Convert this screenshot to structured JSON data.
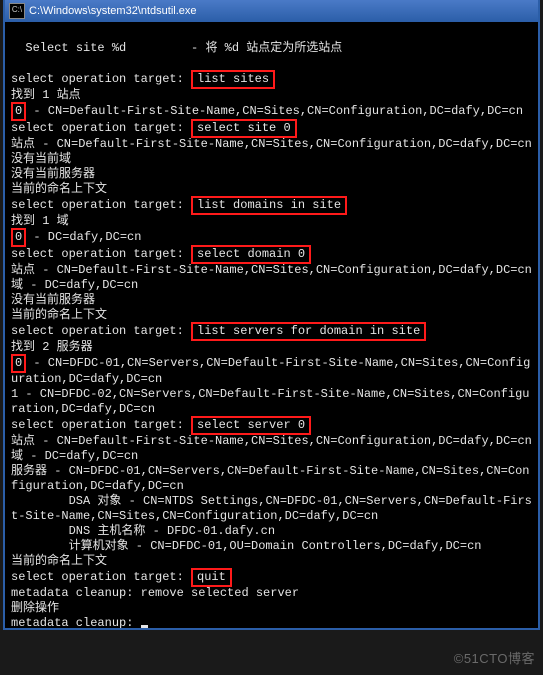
{
  "title": "C:\\Windows\\system32\\ntdsutil.exe",
  "lines": {
    "l1_pre": "  Select site %d",
    "l1_mid": "         - 将 %d 站点定为所选站点",
    "blank": "",
    "prompt": "select operation target: ",
    "cmd_list_sites": "list sites",
    "found1": "找到 1 站点",
    "idx0": "0",
    "site_line": " - CN=Default-First-Site-Name,CN=Sites,CN=Configuration,DC=dafy,DC=cn",
    "cmd_select_site": "select site 0",
    "site_selected": "站点 - CN=Default-First-Site-Name,CN=Sites,CN=Configuration,DC=dafy,DC=cn",
    "no_domain": "没有当前域",
    "no_server": "没有当前服务器",
    "current_nc": "当前的命名上下文",
    "cmd_list_domains": "list domains in site",
    "found1domain": "找到 1 域",
    "domain_line": " - DC=dafy,DC=cn",
    "cmd_select_domain": "select domain 0",
    "domain_label": "域 - DC=dafy,DC=cn",
    "cmd_list_servers": "list servers for domain in site",
    "found2servers": "找到 2 服务器",
    "srv0": " - CN=DFDC-01,CN=Servers,CN=Default-First-Site-Name,CN=Sites,CN=Configuration,DC=dafy,DC=cn",
    "srv1_head": "1 - CN=DFDC-02,CN=Servers,CN=Default-First-Site-Name,CN=Sites,CN=Configuration,DC=dafy,DC=cn",
    "cmd_select_server": "select server 0",
    "domain_sel": "域 - DC=dafy,DC=cn",
    "server_sel": "服务器 - CN=DFDC-01,CN=Servers,CN=Default-First-Site-Name,CN=Sites,CN=Configuration,DC=dafy,DC=cn",
    "dsa_line": "        DSA 对象 - CN=NTDS Settings,CN=DFDC-01,CN=Servers,CN=Default-First-Site-Name,CN=Sites,CN=Configuration,DC=dafy,DC=cn",
    "dns_line": "        DNS 主机名称 - DFDC-01.dafy.cn",
    "computer_line": "        计算机对象 - CN=DFDC-01,OU=Domain Controllers,DC=dafy,DC=cn",
    "cmd_quit": "quit",
    "meta_remove": "metadata cleanup: remove selected server",
    "del_op": "删除操作",
    "meta_prompt": "metadata cleanup: "
  },
  "watermark": "©51CTO博客"
}
